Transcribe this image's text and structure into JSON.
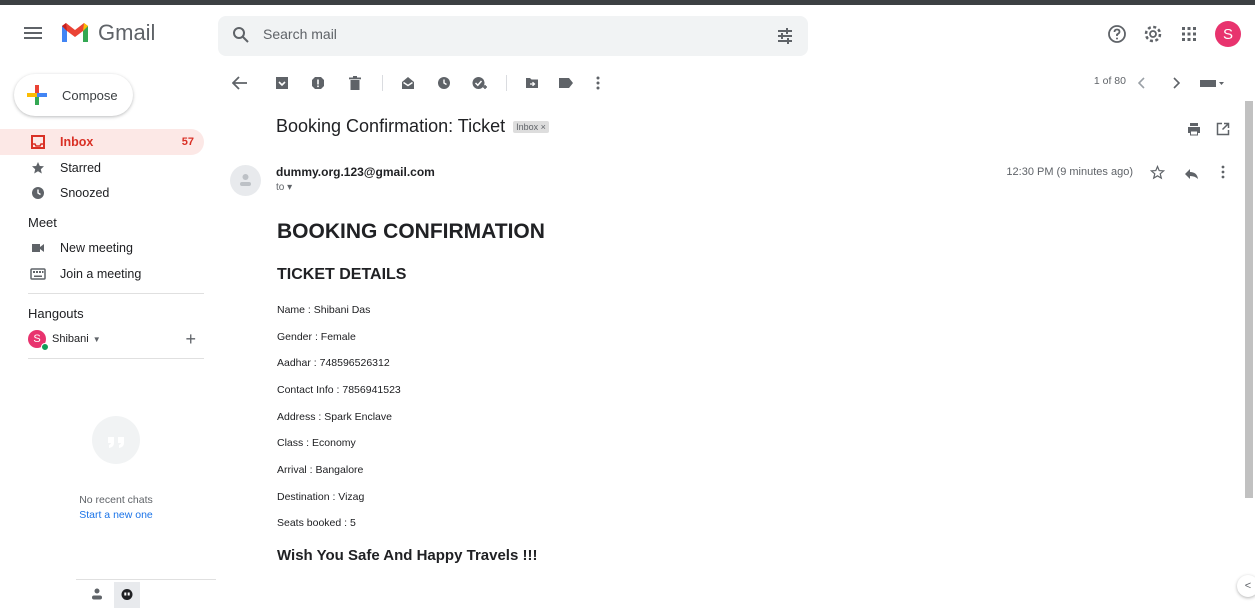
{
  "app": {
    "name": "Gmail"
  },
  "search": {
    "placeholder": "Search mail"
  },
  "header": {
    "avatar_letter": "S"
  },
  "sidebar": {
    "compose_label": "Compose",
    "items": [
      {
        "label": "Inbox",
        "count": "57"
      },
      {
        "label": "Starred"
      },
      {
        "label": "Snoozed"
      }
    ],
    "meet": {
      "title": "Meet",
      "items": [
        {
          "label": "New meeting"
        },
        {
          "label": "Join a meeting"
        }
      ]
    },
    "hangouts": {
      "title": "Hangouts",
      "user_letter": "S",
      "user_name": "Shibani",
      "no_chats": "No recent chats",
      "start_new": "Start a new one"
    }
  },
  "toolbar": {
    "pager": "1 of 80"
  },
  "email": {
    "subject": "Booking Confirmation: Ticket",
    "label_badge": "Inbox ×",
    "sender": "dummy.org.123@gmail.com",
    "to": "to ▾",
    "time": "12:30 PM (9 minutes ago)",
    "heading": "BOOKING CONFIRMATION",
    "subheading": "TICKET DETAILS",
    "fields": [
      "Name : Shibani Das",
      "Gender : Female",
      "Aadhar : 748596526312",
      "Contact Info : 7856941523",
      "Address : Spark Enclave",
      "Class : Economy",
      "Arrival : Bangalore",
      "Destination : Vizag",
      "Seats booked : 5"
    ],
    "closing": "Wish You Safe And Happy Travels !!!"
  },
  "colors": {
    "accent_red": "#d93025",
    "avatar_pink": "#e8336e",
    "online_green": "#0f9d58"
  }
}
